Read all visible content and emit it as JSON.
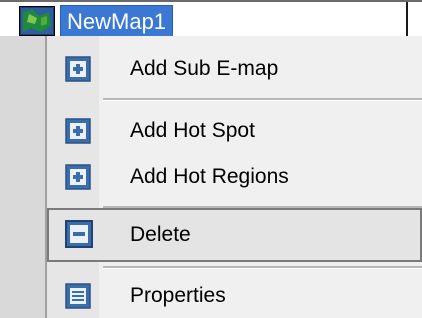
{
  "tree": {
    "node_label": "NewMap1",
    "node_icon": "map-icon"
  },
  "menu": {
    "items": [
      {
        "label": "Add Sub E-map",
        "icon": "add-icon"
      },
      {
        "label": "Add Hot Spot",
        "icon": "add-icon"
      },
      {
        "label": "Add Hot Regions",
        "icon": "add-icon"
      },
      {
        "label": "Delete",
        "icon": "delete-icon",
        "highlighted": true
      },
      {
        "label": "Properties",
        "icon": "properties-icon"
      }
    ]
  },
  "colors": {
    "selection": "#3a78d4",
    "icon_blue": "#3b6ea8",
    "menu_bg": "#f0f0f0",
    "highlight_bg": "#e4e4e4"
  }
}
